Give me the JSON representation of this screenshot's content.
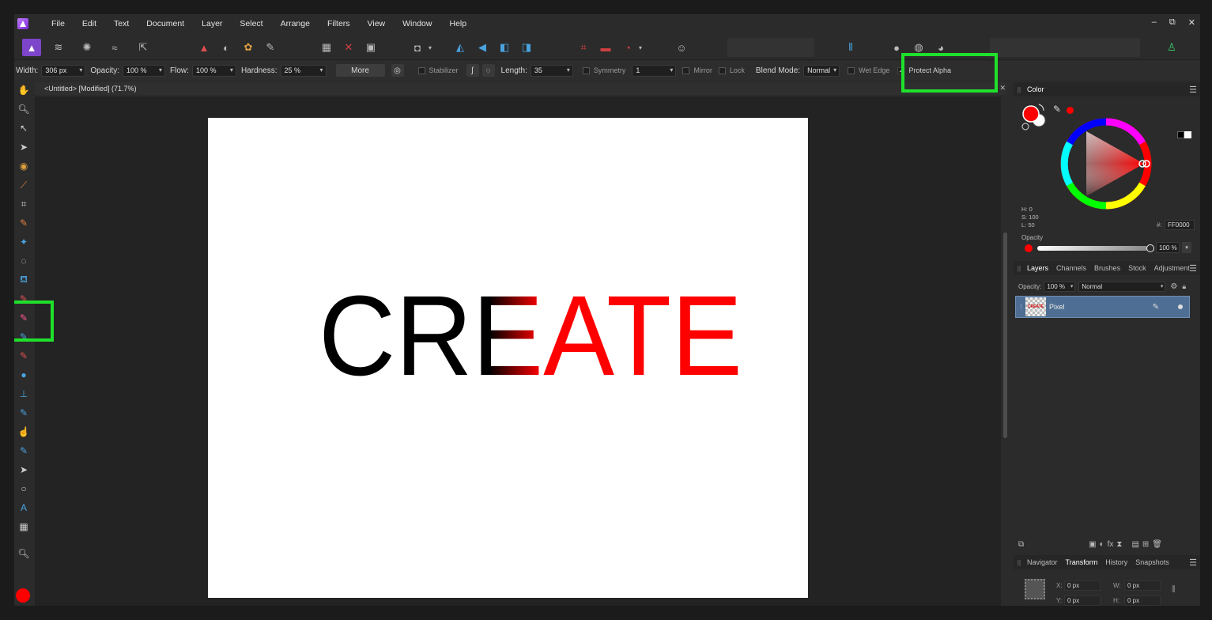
{
  "menubar": {
    "items": [
      "File",
      "Edit",
      "Text",
      "Document",
      "Layer",
      "Select",
      "Arrange",
      "Filters",
      "View",
      "Window",
      "Help"
    ]
  },
  "window_controls": {
    "minimize": "–",
    "restore": "⧉",
    "close": "✕"
  },
  "context_toolbar": {
    "width_label": "Width:",
    "width_value": "306 px",
    "opacity_label": "Opacity:",
    "opacity_value": "100 %",
    "flow_label": "Flow:",
    "flow_value": "100 %",
    "hardness_label": "Hardness:",
    "hardness_value": "25 %",
    "more_label": "More",
    "stabilizer_label": "Stabilizer",
    "length_label": "Length:",
    "length_value": "35",
    "symmetry_label": "Symmetry",
    "symmetry_value": "1",
    "mirror_label": "Mirror",
    "lock_label": "Lock",
    "blend_label": "Blend Mode:",
    "blend_value": "Normal",
    "wet_edges_label": "Wet Edge",
    "protect_alpha_label": "Protect Alpha",
    "protect_alpha_checked": true
  },
  "document": {
    "tab_title": "<Untitled> [Modified] (71.7%)",
    "canvas_text": "CREATE"
  },
  "color_panel": {
    "title": "Color",
    "h": "H: 0",
    "s": "S: 100",
    "l": "L: 50",
    "hex_label": "#:",
    "hex_value": "FF0000",
    "opacity_label": "Opacity",
    "opacity_value": "100 %",
    "current_color": "#ff0000"
  },
  "layers_panel": {
    "tabs": [
      "Layers",
      "Channels",
      "Brushes",
      "Stock",
      "Adjustment"
    ],
    "opacity_label": "Opacity:",
    "opacity_value": "100 %",
    "blend_value": "Normal",
    "layers": [
      {
        "name": "Pixel",
        "thumb_text": "CREATE"
      }
    ]
  },
  "bottom_panel": {
    "tabs": [
      "Navigator",
      "Transform",
      "History",
      "Snapshots"
    ],
    "x_label": "X:",
    "x_value": "0 px",
    "y_label": "Y:",
    "y_value": "0 px",
    "w_label": "W:",
    "w_value": "0 px",
    "h_label": "H:",
    "h_value": "0 px"
  },
  "colors": {
    "accent_persona": "#7d45c9",
    "highlight": "#1fe02b",
    "layer_selected": "#4e6f93"
  }
}
